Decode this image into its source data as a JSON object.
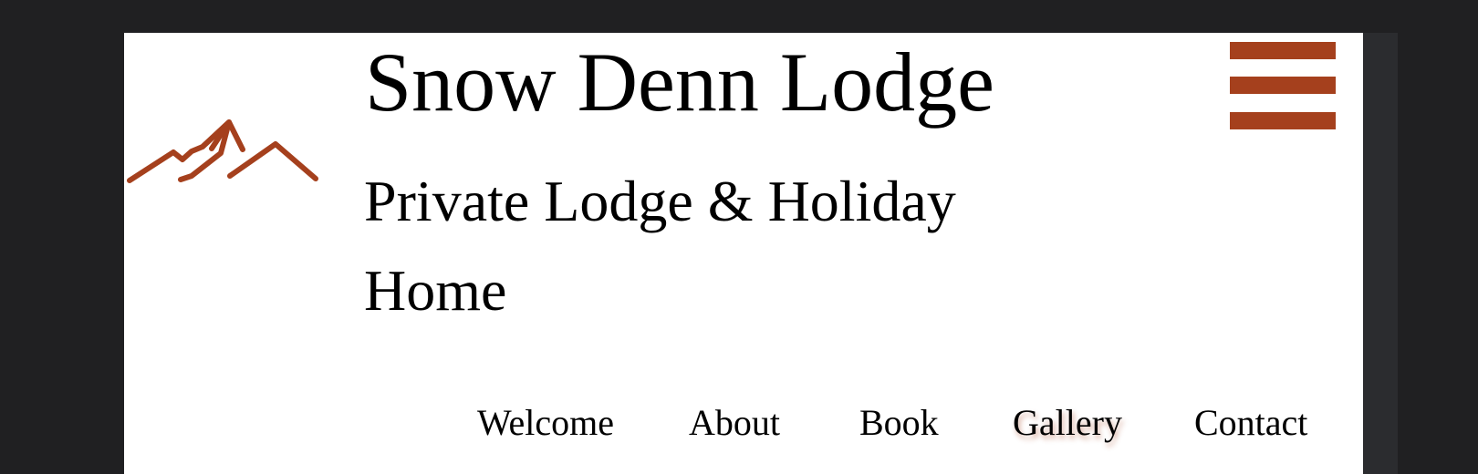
{
  "site": {
    "title": "Snow Denn Lodge",
    "subtitle": "Private Lodge & Holiday Home"
  },
  "nav": {
    "items": [
      {
        "label": "Welcome"
      },
      {
        "label": "About"
      },
      {
        "label": "Book"
      },
      {
        "label": "Gallery",
        "active": true
      },
      {
        "label": "Contact"
      }
    ]
  },
  "theme": {
    "accent": "#a5401d",
    "page_background": "#202022",
    "content_background": "#ffffff"
  },
  "icons": {
    "logo": "mountain-logo-icon",
    "menu": "hamburger-menu-icon"
  }
}
